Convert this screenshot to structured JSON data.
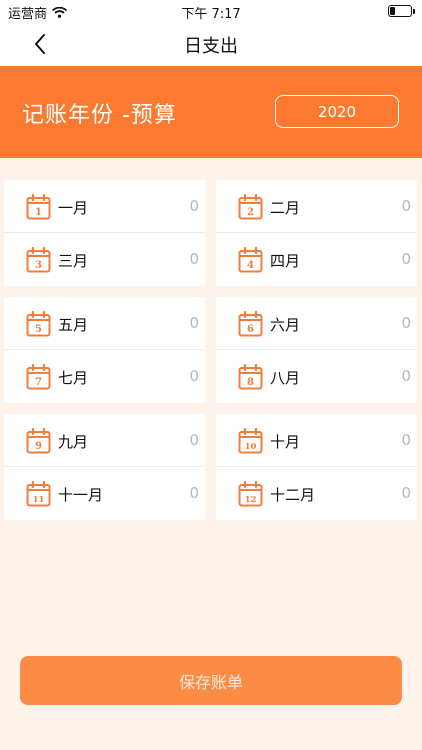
{
  "status_bar": {
    "carrier": "运营商",
    "time": "下午 7:17"
  },
  "nav": {
    "title": "日支出"
  },
  "budget": {
    "title": "记账年份 -预算",
    "year": "2020"
  },
  "months": [
    {
      "num": "1",
      "label": "一月",
      "value": "0"
    },
    {
      "num": "2",
      "label": "二月",
      "value": "0"
    },
    {
      "num": "3",
      "label": "三月",
      "value": "0"
    },
    {
      "num": "4",
      "label": "四月",
      "value": "0"
    },
    {
      "num": "5",
      "label": "五月",
      "value": "0"
    },
    {
      "num": "6",
      "label": "六月",
      "value": "0"
    },
    {
      "num": "7",
      "label": "七月",
      "value": "0"
    },
    {
      "num": "8",
      "label": "八月",
      "value": "0"
    },
    {
      "num": "9",
      "label": "九月",
      "value": "0"
    },
    {
      "num": "10",
      "label": "十月",
      "value": "0"
    },
    {
      "num": "11",
      "label": "十一月",
      "value": "0"
    },
    {
      "num": "12",
      "label": "十二月",
      "value": "0"
    }
  ],
  "actions": {
    "save_label": "保存账单"
  },
  "colors": {
    "accent": "#fb7a2f",
    "button": "#fb8c45",
    "background": "#fdf3eb"
  },
  "icons": {
    "back": "chevron-left-icon",
    "month": "calendar-icon",
    "wifi": "wifi-icon",
    "battery": "battery-icon"
  }
}
